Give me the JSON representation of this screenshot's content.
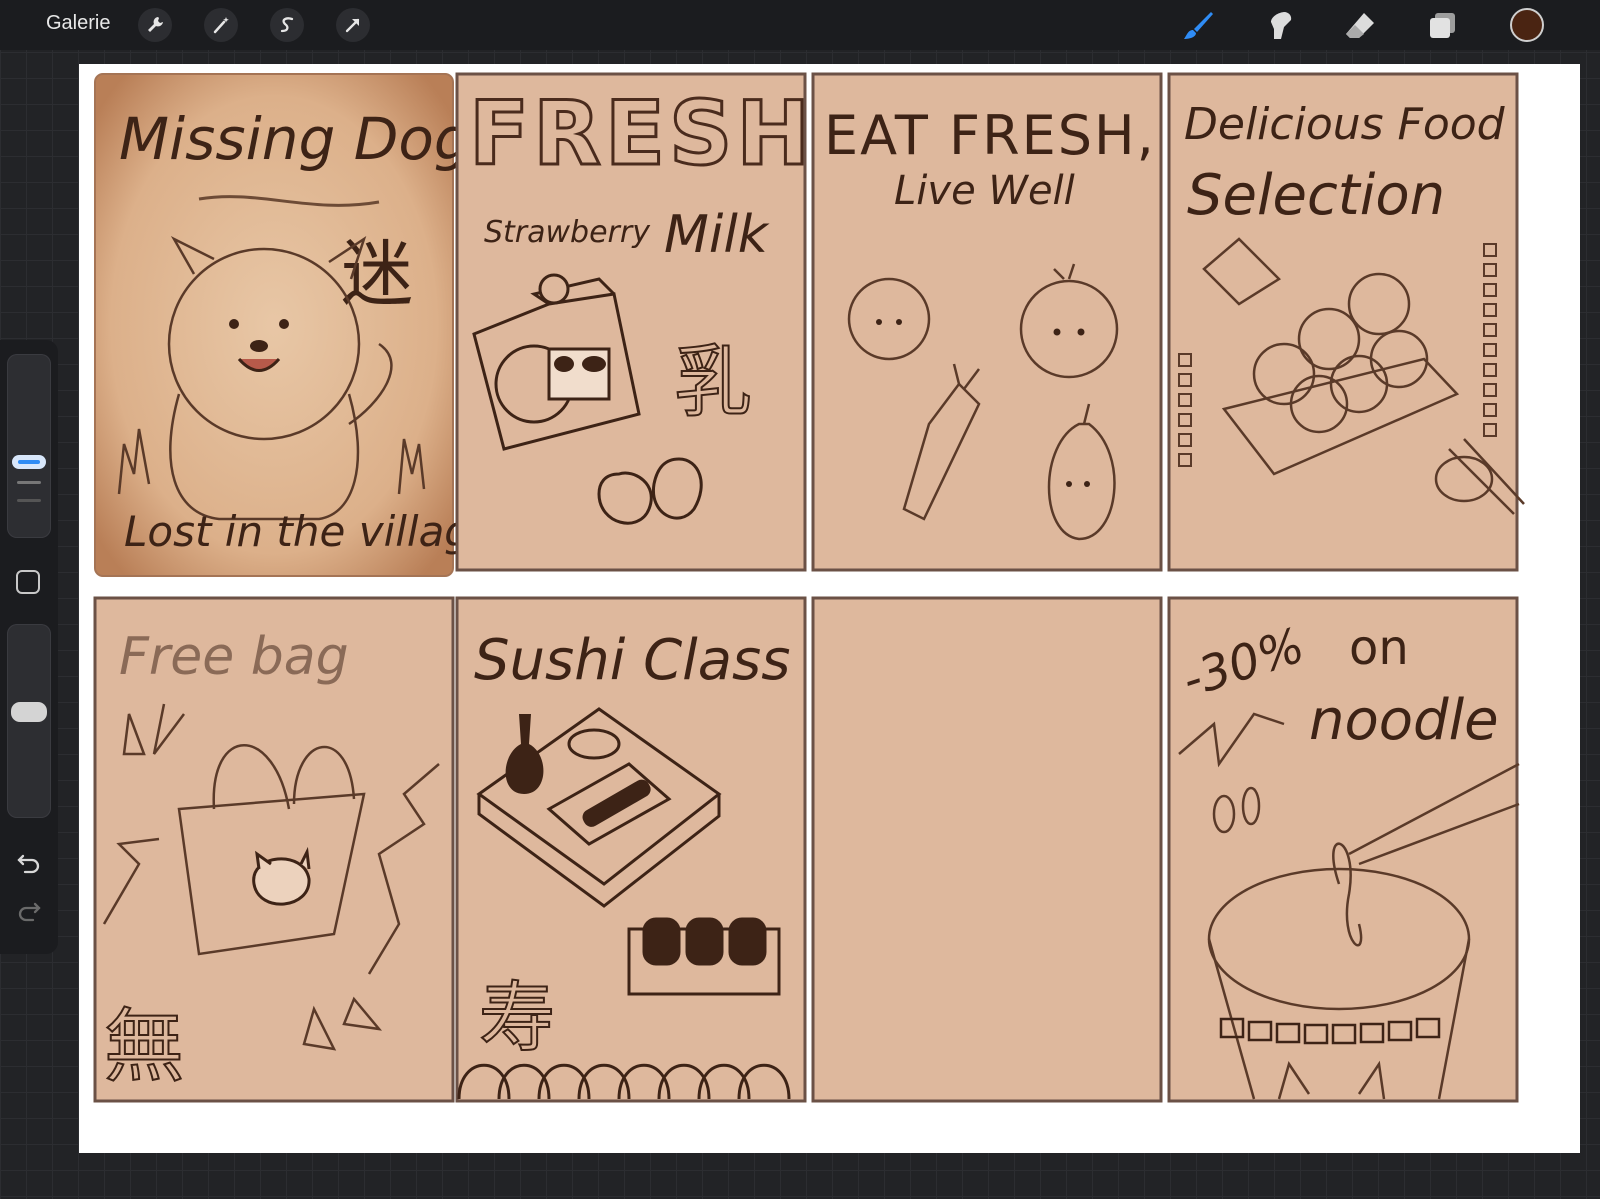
{
  "toolbar": {
    "gallery_label": "Galerie",
    "left_tools": [
      "wrench-icon",
      "magic-wand-icon",
      "selection-s-icon",
      "move-arrow-icon"
    ],
    "right_tools": [
      "brush-icon",
      "smudge-icon",
      "eraser-icon",
      "layers-icon"
    ],
    "current_color": "#4a2412",
    "brush_accent": "#2f8cf5"
  },
  "sidebar": {
    "brush_size_level": 0.25,
    "opacity_level": 0.75,
    "undo_icon": "undo-icon",
    "redo_icon": "redo-icon"
  },
  "canvas": {
    "paper_color": "#deb89d",
    "ink_color": "#3d2316",
    "panels": [
      {
        "title": "Missing Dog",
        "kanji": "迷",
        "caption": "Lost in the villag"
      },
      {
        "title": "FRESH",
        "subtitle_left": "Strawberry",
        "subtitle_right": "Milk",
        "kanji": "乳"
      },
      {
        "title": "EAT FRESH,",
        "subtitle": "Live Well"
      },
      {
        "title_line1": "Delicious Food",
        "title_line2": "Selection"
      },
      {
        "title": "Free bag",
        "kanji": "無"
      },
      {
        "title": "Sushi Class",
        "kanji": "寿"
      },
      {
        "title": ""
      },
      {
        "title_line1": "-30%",
        "title_line2": "on",
        "title_line3": "noodle"
      }
    ]
  }
}
